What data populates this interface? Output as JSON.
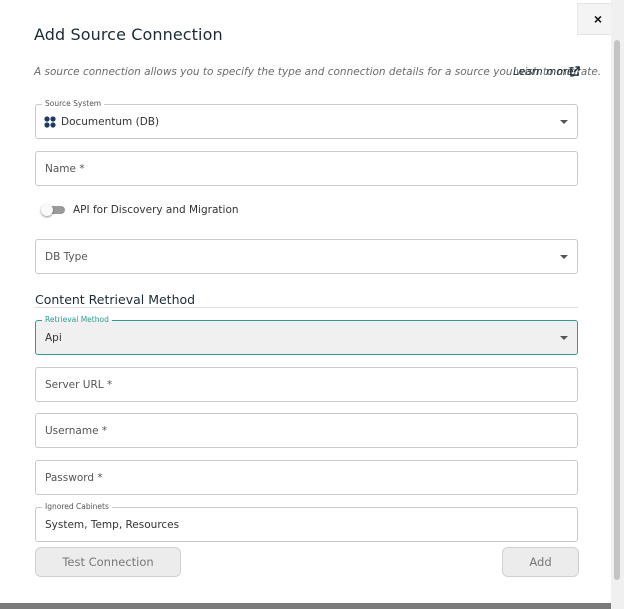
{
  "dialog": {
    "title": "Add Source Connection",
    "close_label": "×",
    "description": "A source connection allows you to specify the type and connection details for a source you wish to migrate.",
    "learn_more": "Learn more"
  },
  "source_system": {
    "legend": "Source System",
    "value": "Documentum (DB)",
    "icon": "documentum-icon"
  },
  "name_field": {
    "placeholder": "Name *"
  },
  "api_toggle": {
    "label": "API for Discovery and Migration",
    "checked": false
  },
  "db_type": {
    "placeholder": "DB Type"
  },
  "content_retrieval": {
    "title": "Content Retrieval Method",
    "retrieval_method": {
      "legend": "Retrieval Method",
      "value": "Api"
    },
    "server_url": {
      "placeholder": "Server URL *"
    },
    "username": {
      "placeholder": "Username *"
    },
    "password": {
      "placeholder": "Password *"
    },
    "ignored_cabinets": {
      "legend": "Ignored Cabinets",
      "value": "System, Temp, Resources"
    }
  },
  "buttons": {
    "test_connection": "Test Connection",
    "add": "Add"
  },
  "colors": {
    "accent": "#2e9d91",
    "title": "#1c2b36",
    "button_bg": "#ececec"
  }
}
